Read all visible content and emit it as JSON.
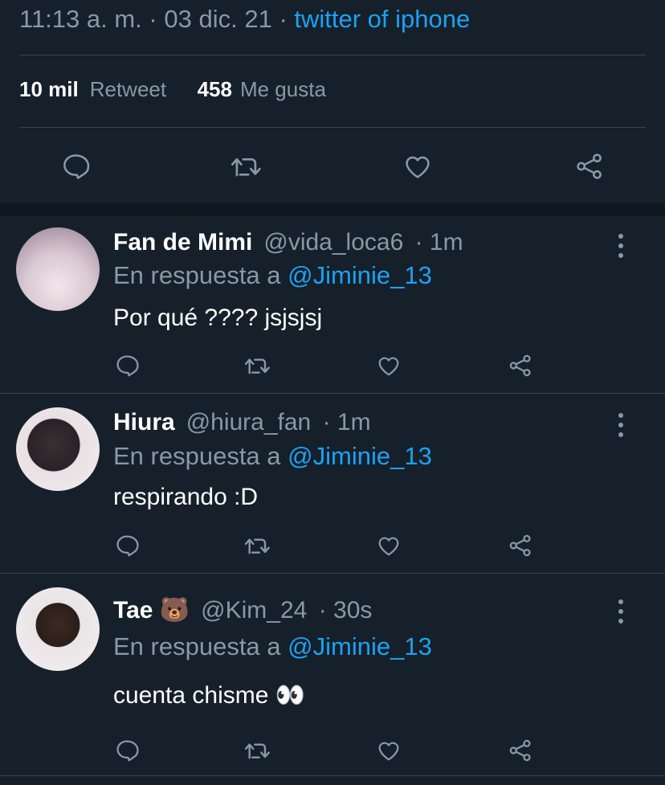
{
  "tweet_meta": {
    "time": "11:13 a. m.",
    "separator": "·",
    "date": "03 dic. 21",
    "source": "twitter of iphone"
  },
  "stats": {
    "retweets_count": "10 mil",
    "retweets_label": "Retweet",
    "likes_count": "458",
    "likes_label": "Me gusta"
  },
  "actions": [
    "reply-icon",
    "retweet-icon",
    "like-icon",
    "share-icon"
  ],
  "colors": {
    "background": "#15202b",
    "accent": "#1da1f2",
    "muted": "#8899a6",
    "divider": "#38444d"
  },
  "replies": [
    {
      "name": "Fan de Mimi",
      "handle": "@vida_loca6",
      "time": "· 1m",
      "replying_prefix": "En respuesta a",
      "replying_to": "@Jiminie_13",
      "text": "Por qué  ???? jsjsjsj"
    },
    {
      "name": "Hiura",
      "handle": "@hiura_fan",
      "time": "· 1m",
      "replying_prefix": "En respuesta a",
      "replying_to": "@Jiminie_13",
      "text": "respirando :D"
    },
    {
      "name": "Tae 🐻",
      "handle": "@Kim_24",
      "time": "· 30s",
      "replying_prefix": "En respuesta a",
      "replying_to": "@Jiminie_13",
      "text": "cuenta chisme 👀"
    }
  ]
}
